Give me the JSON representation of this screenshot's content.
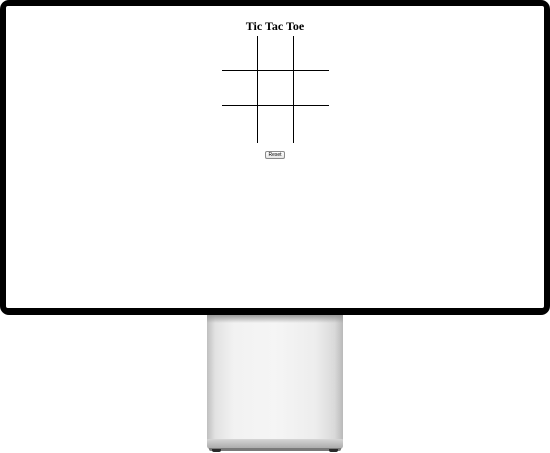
{
  "page": {
    "title": "Tic Tac Toe",
    "reset_label": "Reset"
  },
  "board": {
    "cells": [
      "",
      "",
      "",
      "",
      "",
      "",
      "",
      "",
      ""
    ]
  }
}
